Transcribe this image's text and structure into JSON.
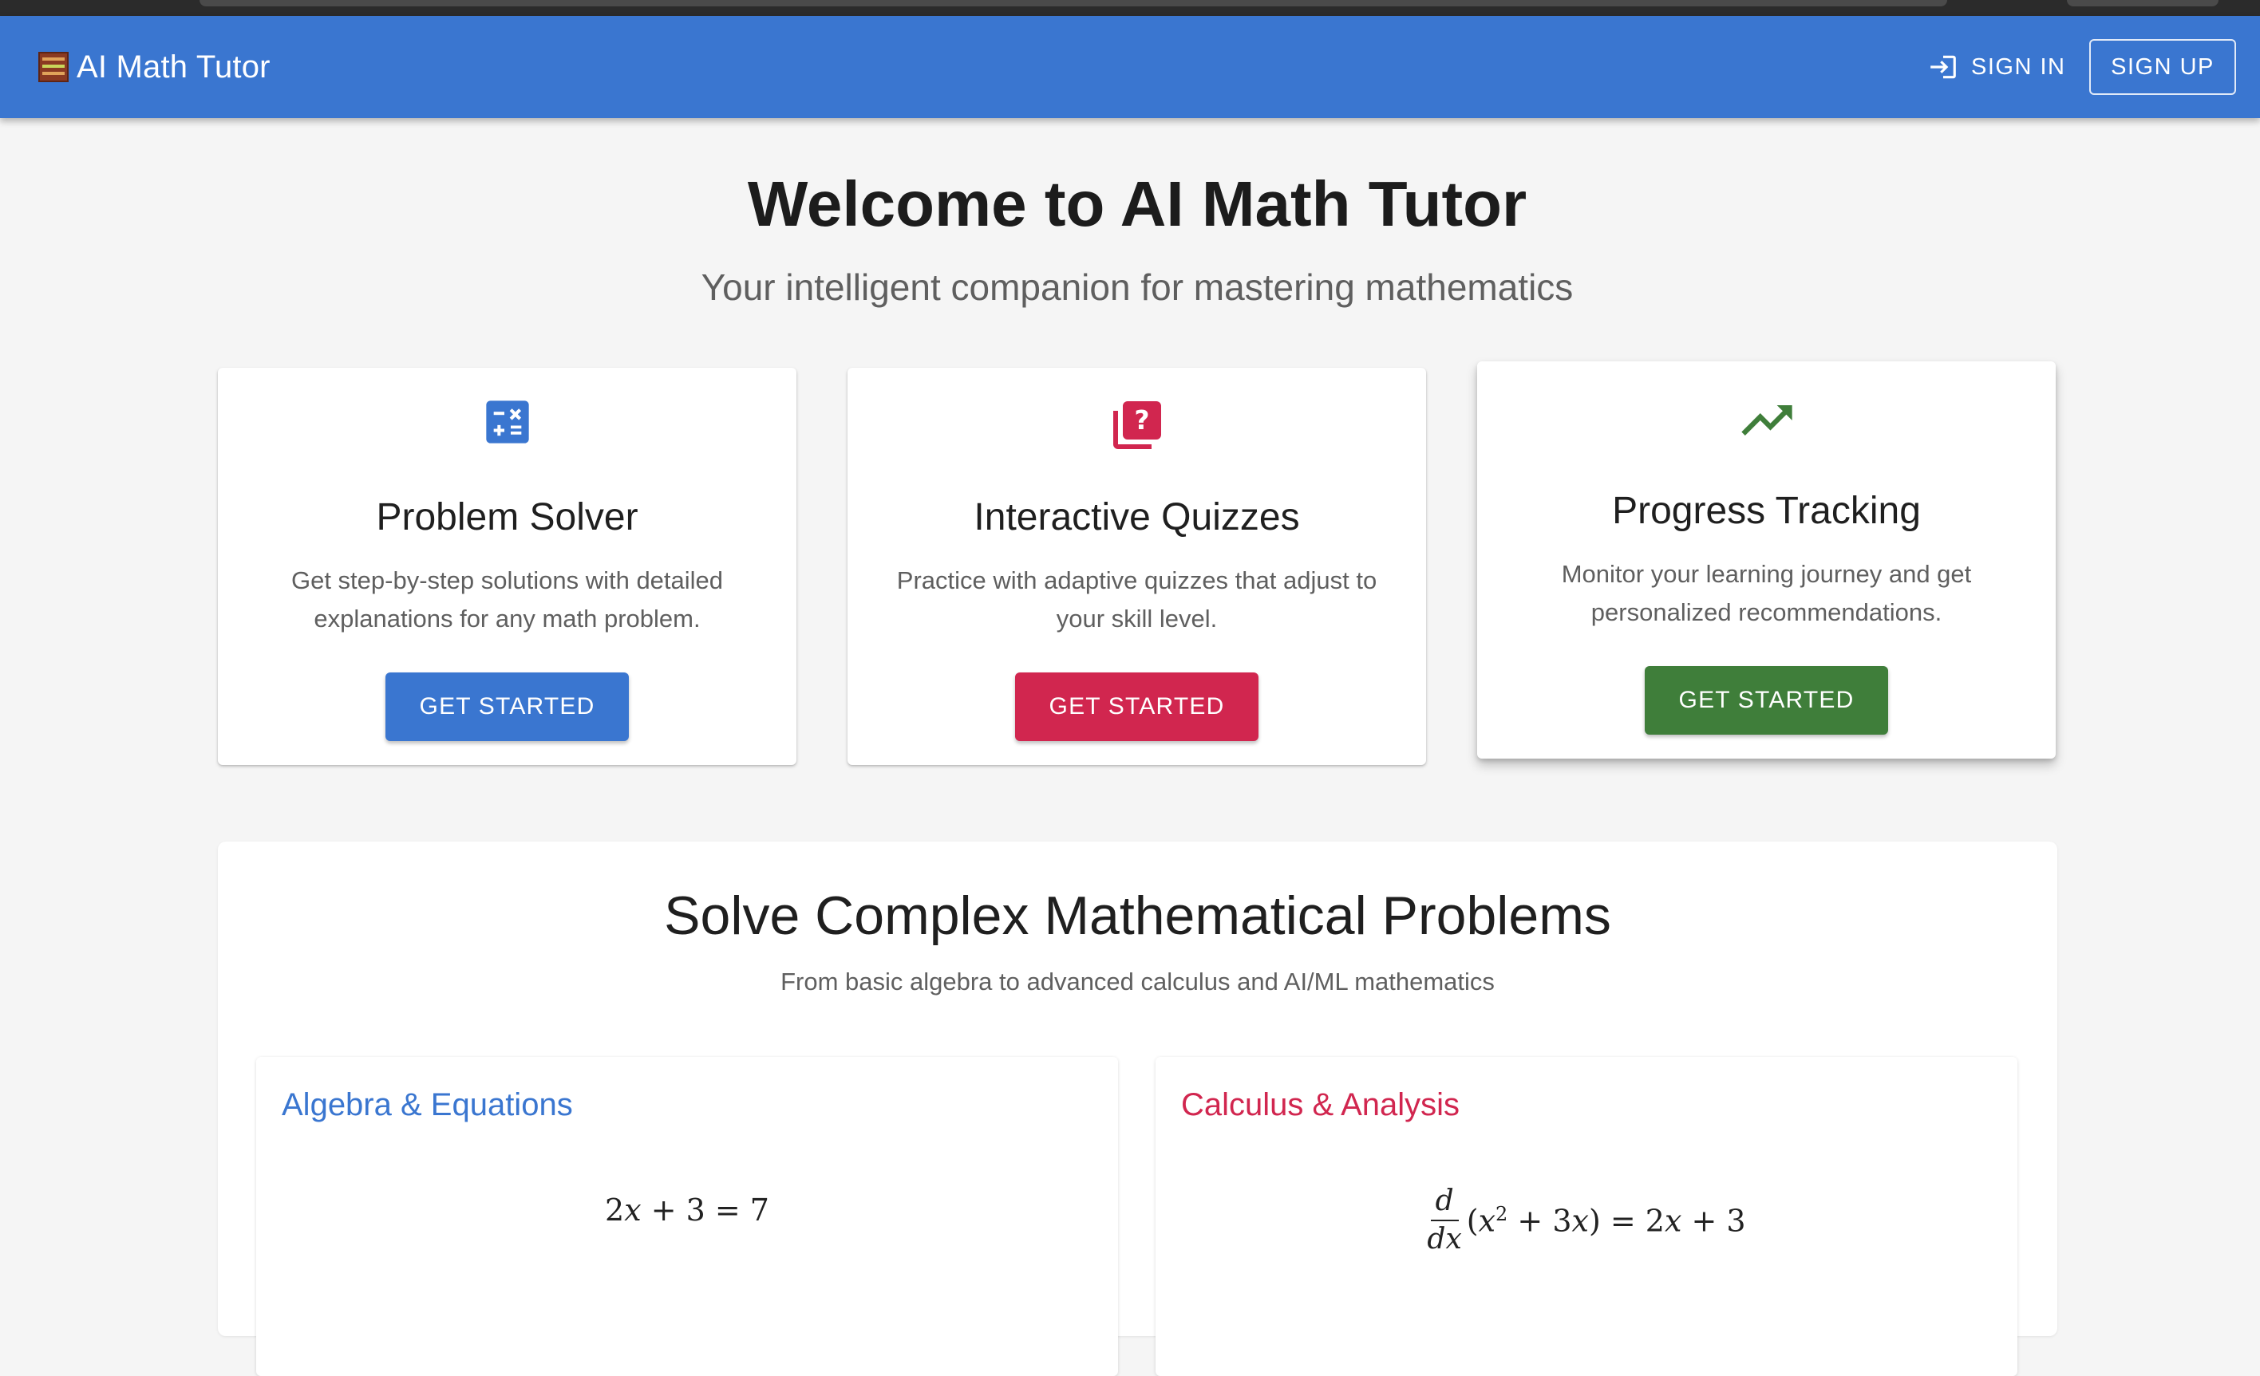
{
  "appbar": {
    "title": "AI Math Tutor",
    "signin_label": "SIGN IN",
    "signup_label": "SIGN UP",
    "color": "#3a76d0"
  },
  "hero": {
    "title": "Welcome to AI Math Tutor",
    "subtitle": "Your intelligent companion for mastering mathematics"
  },
  "features": [
    {
      "icon": "calculator-icon",
      "title": "Problem Solver",
      "description": "Get step-by-step solutions with detailed explanations for any math problem.",
      "button_label": "GET STARTED",
      "color": "#3a76d0"
    },
    {
      "icon": "quiz-icon",
      "title": "Interactive Quizzes",
      "description": "Practice with adaptive quizzes that adjust to your skill level.",
      "button_label": "GET STARTED",
      "color": "#d1264f"
    },
    {
      "icon": "trending-up-icon",
      "title": "Progress Tracking",
      "description": "Monitor your learning journey and get personalized recommendations.",
      "button_label": "GET STARTED",
      "color": "#3f7e3a"
    }
  ],
  "section": {
    "title": "Solve Complex Mathematical Problems",
    "subtitle": "From basic algebra to advanced calculus and AI/ML mathematics",
    "topics": [
      {
        "title": "Algebra & Equations",
        "color": "#3a76d0",
        "equation": "2x + 3 = 7"
      },
      {
        "title": "Calculus & Analysis",
        "color": "#d1264f",
        "equation": "d/dx (x^2 + 3x) = 2x + 3"
      }
    ]
  }
}
